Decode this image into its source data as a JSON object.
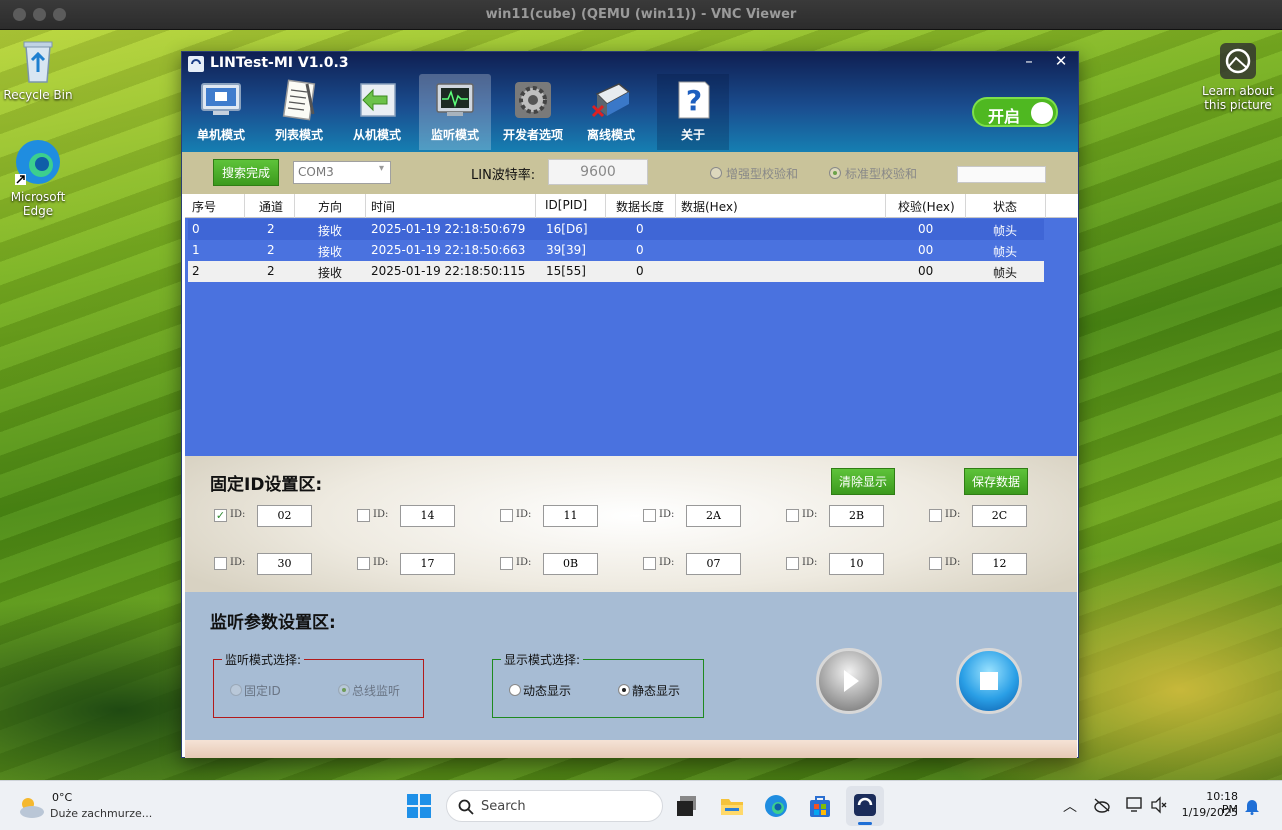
{
  "mac_window": {
    "title": "win11(cube) (QEMU (win11)) - VNC Viewer"
  },
  "desktop": {
    "icons": [
      {
        "label": "Recycle Bin",
        "icon": "recycle-bin-icon"
      },
      {
        "label": "Microsoft Edge",
        "icon": "edge-icon"
      }
    ],
    "learn": {
      "label": "Learn about this picture",
      "icon": "camera-icon"
    }
  },
  "app": {
    "title": "LINTest-MI V1.0.3",
    "tabs": [
      {
        "label": "单机模式",
        "icon": "monitor-icon"
      },
      {
        "label": "列表模式",
        "icon": "notepad-icon"
      },
      {
        "label": "从机模式",
        "icon": "arrow-icon"
      },
      {
        "label": "监听模式",
        "icon": "waveform-icon",
        "active": true
      },
      {
        "label": "开发者选项",
        "icon": "gear-icon"
      },
      {
        "label": "离线模式",
        "icon": "printer-icon"
      },
      {
        "label": "关于",
        "icon": "help-icon"
      }
    ],
    "power_label": "开启",
    "controls": {
      "search_button": "搜索完成",
      "com_port": "COM3",
      "baud_label": "LIN波特率:",
      "baud_value": "9600",
      "checksum_enhanced": "增强型校验和",
      "checksum_standard": "标准型校验和",
      "checksum_selected": "standard"
    },
    "table": {
      "headers": [
        "序号",
        "通道",
        "方向",
        "时间",
        "ID[PID]",
        "数据长度",
        "数据(Hex)",
        "校验(Hex)",
        "状态"
      ],
      "rows": [
        [
          "0",
          "2",
          "接收",
          "2025-01-19 22:18:50:679",
          "16[D6]",
          "0",
          "",
          "00",
          "帧头"
        ],
        [
          "1",
          "2",
          "接收",
          "2025-01-19 22:18:50:663",
          "39[39]",
          "0",
          "",
          "00",
          "帧头"
        ],
        [
          "2",
          "2",
          "接收",
          "2025-01-19 22:18:50:115",
          "15[55]",
          "0",
          "",
          "00",
          "帧头"
        ]
      ],
      "selected_row": 2
    },
    "fixed_id": {
      "title": "固定ID设置区:",
      "clear_button": "清除显示",
      "save_button": "保存数据",
      "id_label": "ID:",
      "ids": [
        {
          "value": "02",
          "checked": true
        },
        {
          "value": "14",
          "checked": false
        },
        {
          "value": "11",
          "checked": false
        },
        {
          "value": "2A",
          "checked": false
        },
        {
          "value": "2B",
          "checked": false
        },
        {
          "value": "2C",
          "checked": false
        },
        {
          "value": "30",
          "checked": false
        },
        {
          "value": "17",
          "checked": false
        },
        {
          "value": "0B",
          "checked": false
        },
        {
          "value": "07",
          "checked": false
        },
        {
          "value": "10",
          "checked": false
        },
        {
          "value": "12",
          "checked": false
        }
      ]
    },
    "monitor": {
      "title": "监听参数设置区:",
      "mode_group": "监听模式选择:",
      "mode_fixed": "固定ID",
      "mode_bus": "总线监听",
      "mode_selected": "bus",
      "display_group": "显示模式选择:",
      "display_dynamic": "动态显示",
      "display_static": "静态显示",
      "display_selected": "static"
    }
  },
  "taskbar": {
    "weather_temp": "0°C",
    "weather_desc": "Duże zachmurze...",
    "search_placeholder": "Search",
    "time": "10:18 PM",
    "date": "1/19/2025"
  }
}
